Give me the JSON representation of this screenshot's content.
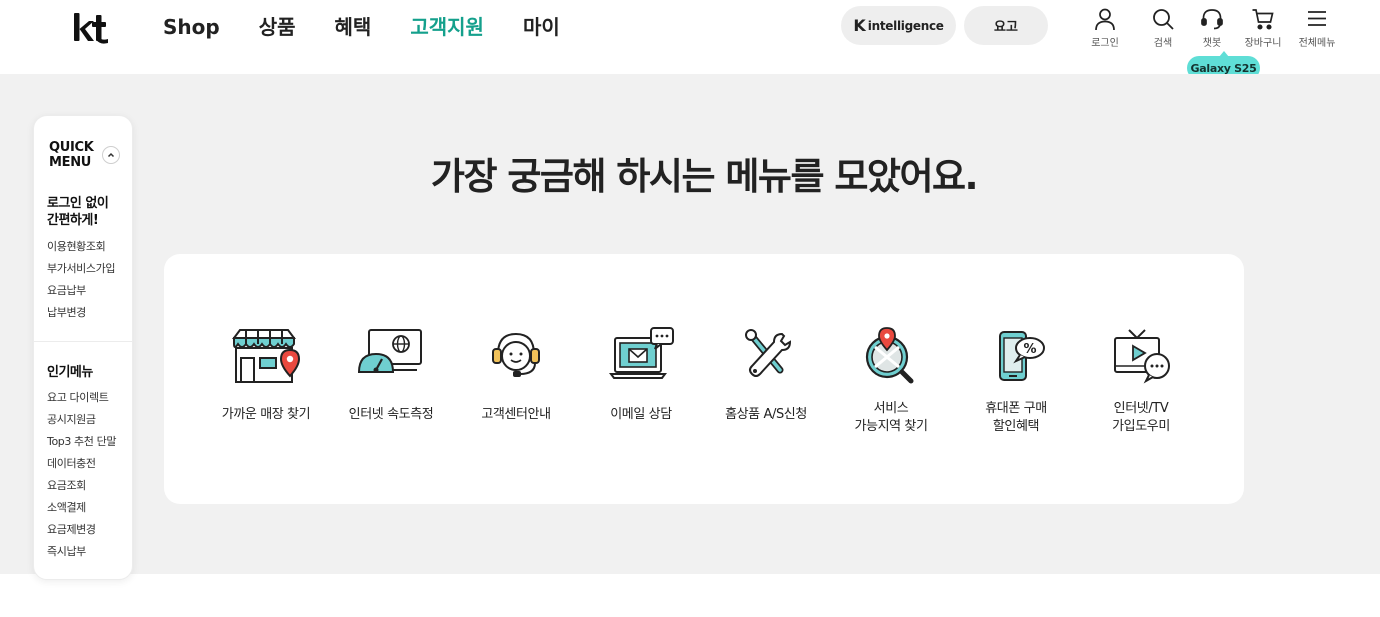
{
  "header": {
    "logo_text": "kt",
    "nav": [
      "Shop",
      "상품",
      "혜택",
      "고객지원",
      "마이"
    ],
    "active_nav": "고객지원",
    "ki_mark": "K",
    "ki_text": "intelligence",
    "yogo_label": "요고",
    "utils": {
      "login": "로그인",
      "search": "검색",
      "chatbot": "챗봇",
      "cart": "장바구니",
      "allmenu": "전체메뉴"
    },
    "badge": "Galaxy S25"
  },
  "quick_menu": {
    "title_line1": "QUICK",
    "title_line2": "MENU",
    "section1_title_line1": "로그인 없이",
    "section1_title_line2": "간편하게!",
    "section1_items": [
      "이용현황조회",
      "부가서비스가입",
      "요금납부",
      "납부변경"
    ],
    "section2_title": "인기메뉴",
    "section2_items": [
      "요고 다이렉트",
      "공시지원금",
      "Top3 추천 단말",
      "데이터충전",
      "요금조회",
      "소액결제",
      "요금제변경",
      "즉시납부"
    ]
  },
  "main": {
    "headline": "가장 궁금해 하시는 메뉴를 모았어요.",
    "services": [
      {
        "label": "가까운 매장 찾기"
      },
      {
        "label": "인터넷 속도측정"
      },
      {
        "label": "고객센터안내"
      },
      {
        "label": "이메일 상담"
      },
      {
        "label": "홈상품 A/S신청"
      },
      {
        "label": "서비스\n가능지역 찾기"
      },
      {
        "label": "휴대폰 구매\n할인혜택"
      },
      {
        "label": "인터넷/TV\n가입도우미"
      }
    ]
  },
  "colors": {
    "accent": "#14a08c",
    "badge": "#5fded6",
    "icon_teal": "#6fcfd0",
    "icon_red": "#e9493f",
    "icon_yellow": "#f1c25a",
    "band_bg": "#f1f1f1"
  }
}
